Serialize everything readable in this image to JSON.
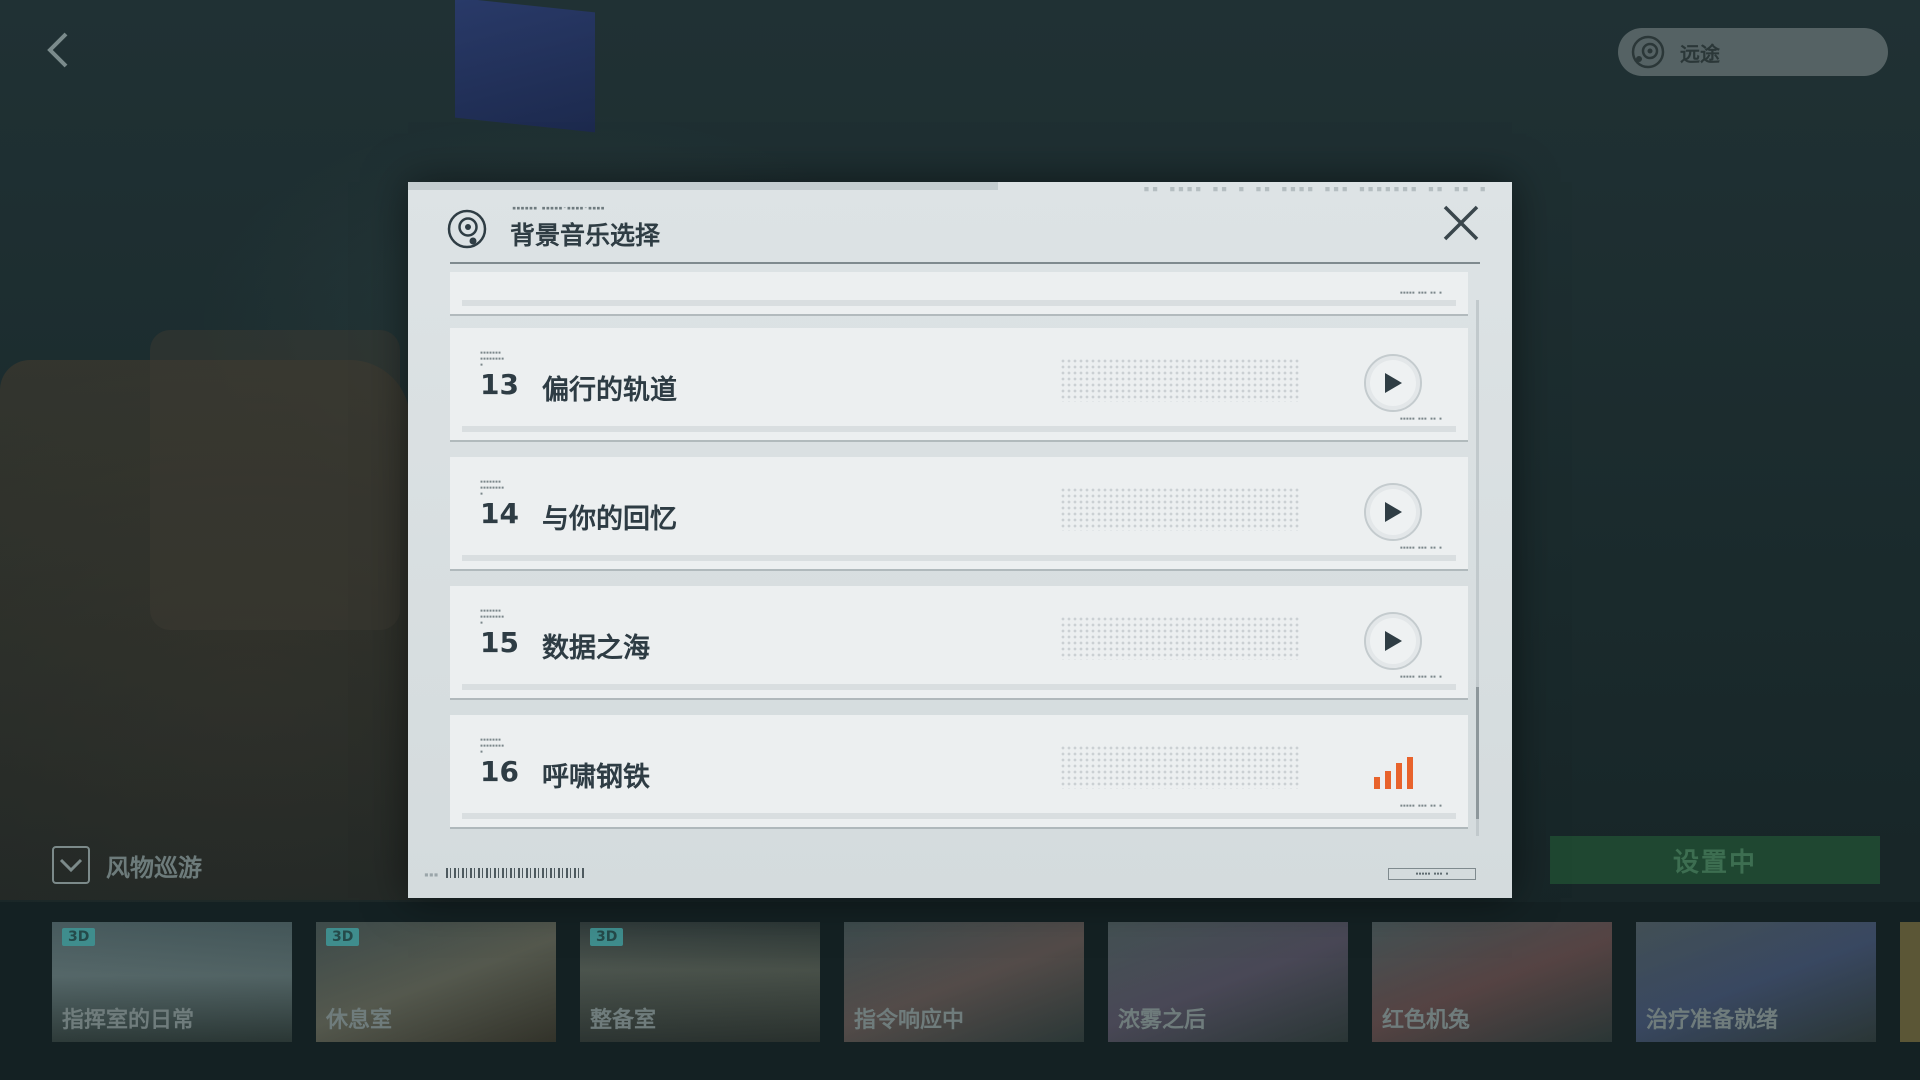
{
  "header": {
    "now_playing": "远途"
  },
  "modal": {
    "title": "背景音乐选择",
    "tracks": [
      {
        "number": "13",
        "title": "偏行的轨道",
        "state": "play"
      },
      {
        "number": "14",
        "title": "与你的回忆",
        "state": "play"
      },
      {
        "number": "15",
        "title": "数据之海",
        "state": "play"
      },
      {
        "number": "16",
        "title": "呼啸钢铁",
        "state": "playing"
      }
    ]
  },
  "category": {
    "label": "风物巡游"
  },
  "set_button": {
    "label": "设置中"
  },
  "backgrounds": [
    {
      "badge": "3D",
      "name": "指挥室的日常"
    },
    {
      "badge": "3D",
      "name": "休息室"
    },
    {
      "badge": "3D",
      "name": "整备室"
    },
    {
      "badge": "",
      "name": "指令响应中"
    },
    {
      "badge": "",
      "name": "浓雾之后"
    },
    {
      "badge": "",
      "name": "红色机兔"
    },
    {
      "badge": "",
      "name": "治疗准备就绪"
    }
  ],
  "colors": {
    "accent_playing": "#e8632c",
    "set_button_bg": "#1f4731",
    "modal_bg": "#dde3e5"
  },
  "icons": {
    "back": "chevron-left-icon",
    "music": "music-disc-icon",
    "close": "close-icon",
    "play": "play-icon",
    "playing": "equalizer-icon",
    "collapse": "chevron-down-icon"
  }
}
